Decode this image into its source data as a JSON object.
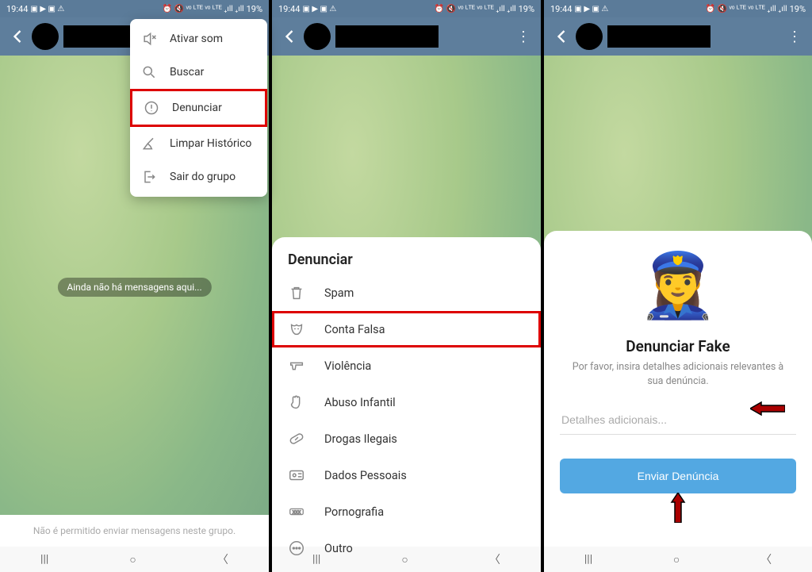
{
  "statusbar": {
    "time": "19:44",
    "icons_left": "▣ ▶ ▣ ⚠",
    "icons_right": "⏰ 🔇 ᵛᵒ ᴸᵀᴱ ᵛᵒ ᴸᵀᴱ ₊ıll ₊ıll",
    "battery": "19%"
  },
  "phone1": {
    "empty_msg": "Ainda não há mensagens aqui...",
    "menu": [
      {
        "label": "Ativar som",
        "icon": "sound-off-icon"
      },
      {
        "label": "Buscar",
        "icon": "search-icon"
      },
      {
        "label": "Denunciar",
        "icon": "alert-circle-icon"
      },
      {
        "label": "Limpar Histórico",
        "icon": "broom-icon"
      },
      {
        "label": "Sair do grupo",
        "icon": "exit-icon"
      }
    ],
    "bottom_text": "Não é permitido enviar mensagens neste grupo."
  },
  "phone2": {
    "sheet_title": "Denunciar",
    "options": [
      {
        "label": "Spam",
        "icon": "trash-icon"
      },
      {
        "label": "Conta Falsa",
        "icon": "mask-icon"
      },
      {
        "label": "Violência",
        "icon": "gun-icon"
      },
      {
        "label": "Abuso Infantil",
        "icon": "hand-icon"
      },
      {
        "label": "Drogas Ilegais",
        "icon": "pill-icon"
      },
      {
        "label": "Dados Pessoais",
        "icon": "id-card-icon"
      },
      {
        "label": "Pornografia",
        "icon": "xxx-icon"
      },
      {
        "label": "Outro",
        "icon": "dots-circle-icon"
      }
    ]
  },
  "phone3": {
    "title": "Denunciar Fake",
    "subtitle": "Por favor, insira detalhes adicionais relevantes à sua denúncia.",
    "placeholder": "Detalhes adicionais...",
    "submit": "Enviar Denúncia"
  },
  "nav": {
    "recent": "|||",
    "home": "○",
    "back": "〈"
  }
}
